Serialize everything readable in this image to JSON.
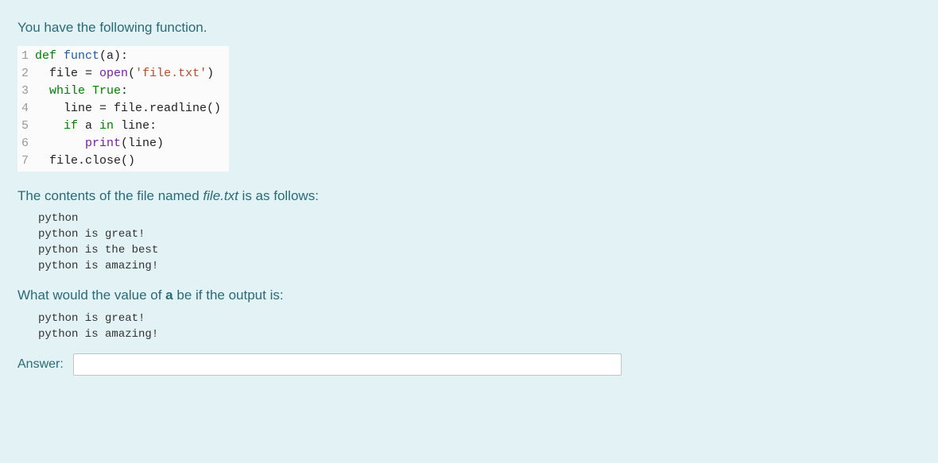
{
  "intro": "You have the following function.",
  "code": {
    "lines": [
      {
        "n": "1",
        "tokens": [
          {
            "t": "def ",
            "c": "tok-def"
          },
          {
            "t": "funct",
            "c": "tok-func"
          },
          {
            "t": "(a):",
            "c": "tok-plain"
          }
        ]
      },
      {
        "n": "2",
        "tokens": [
          {
            "t": "  file ",
            "c": "tok-plain"
          },
          {
            "t": "=",
            "c": "tok-plain"
          },
          {
            "t": " ",
            "c": "tok-plain"
          },
          {
            "t": "open",
            "c": "tok-builtin"
          },
          {
            "t": "(",
            "c": "tok-plain"
          },
          {
            "t": "'file.txt'",
            "c": "tok-string"
          },
          {
            "t": ")",
            "c": "tok-plain"
          }
        ]
      },
      {
        "n": "3",
        "tokens": [
          {
            "t": "  ",
            "c": "tok-plain"
          },
          {
            "t": "while ",
            "c": "tok-keyword"
          },
          {
            "t": "True",
            "c": "tok-const"
          },
          {
            "t": ":",
            "c": "tok-plain"
          }
        ]
      },
      {
        "n": "4",
        "tokens": [
          {
            "t": "    line ",
            "c": "tok-plain"
          },
          {
            "t": "=",
            "c": "tok-plain"
          },
          {
            "t": " file.readline()",
            "c": "tok-plain"
          }
        ]
      },
      {
        "n": "5",
        "tokens": [
          {
            "t": "    ",
            "c": "tok-plain"
          },
          {
            "t": "if ",
            "c": "tok-keyword"
          },
          {
            "t": "a ",
            "c": "tok-plain"
          },
          {
            "t": "in ",
            "c": "tok-keyword"
          },
          {
            "t": "line:",
            "c": "tok-plain"
          }
        ]
      },
      {
        "n": "6",
        "tokens": [
          {
            "t": "       ",
            "c": "tok-plain"
          },
          {
            "t": "print",
            "c": "tok-builtin"
          },
          {
            "t": "(line)",
            "c": "tok-plain"
          }
        ]
      },
      {
        "n": "7",
        "tokens": [
          {
            "t": "  file.close()",
            "c": "tok-plain"
          }
        ]
      }
    ]
  },
  "desc_prefix": "The contents of the file named ",
  "desc_filename": "file.txt",
  "desc_suffix": " is as follows:",
  "file_contents": "python\npython is great!\npython is the best\npython is amazing!",
  "question_prefix": "What would the value of ",
  "question_var": "a",
  "question_suffix": " be if the output is:",
  "expected_output": "python is great!\npython is amazing!",
  "answer_label": "Answer:",
  "answer_value": ""
}
